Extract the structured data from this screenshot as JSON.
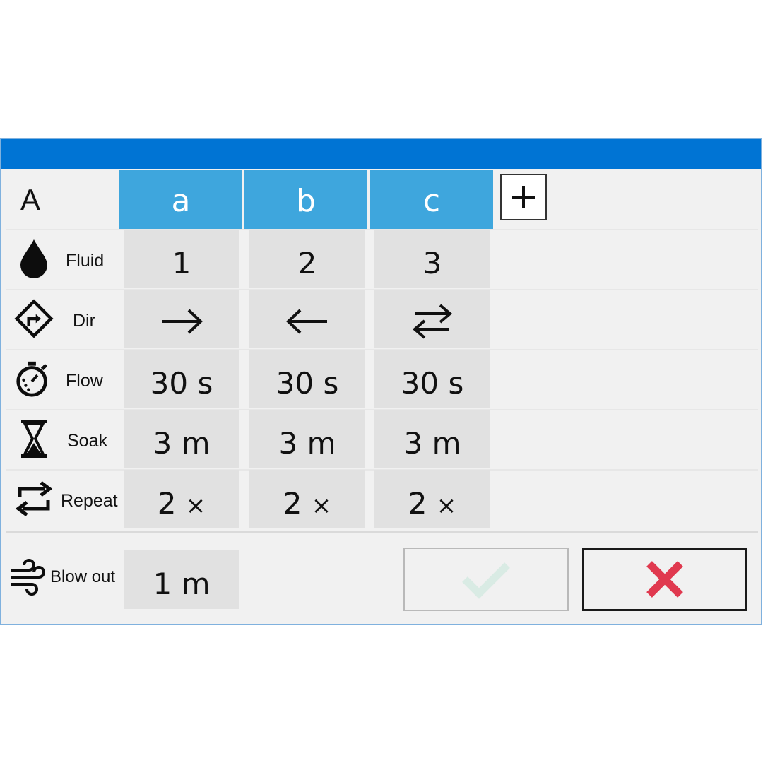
{
  "program": {
    "name": "A",
    "add_label": "+",
    "columns": [
      {
        "name": "a",
        "fluid": "1",
        "dir": "right",
        "flow": "30 s",
        "soak": "3 m",
        "repeat": "2",
        "repeat_suffix": "×"
      },
      {
        "name": "b",
        "fluid": "2",
        "dir": "left",
        "flow": "30 s",
        "soak": "3 m",
        "repeat": "2",
        "repeat_suffix": "×"
      },
      {
        "name": "c",
        "fluid": "3",
        "dir": "both",
        "flow": "30 s",
        "soak": "3 m",
        "repeat": "2",
        "repeat_suffix": "×"
      }
    ]
  },
  "rows": {
    "fluid": {
      "label": "Fluid",
      "icon": "drop-icon"
    },
    "dir": {
      "label": "Dir",
      "icon": "direction-sign-icon"
    },
    "flow": {
      "label": "Flow",
      "icon": "stopwatch-icon"
    },
    "soak": {
      "label": "Soak",
      "icon": "hourglass-icon"
    },
    "repeat": {
      "label": "Repeat",
      "icon": "repeat-icon"
    }
  },
  "blowout": {
    "label": "Blow out",
    "icon": "wind-icon",
    "value": "1 m"
  },
  "colors": {
    "titlebar": "#0074d4",
    "column_header": "#3ea6dd",
    "cell": "#e1e1e1",
    "confirm_check": "#d9ebe4",
    "cancel_x": "#e0394f"
  }
}
